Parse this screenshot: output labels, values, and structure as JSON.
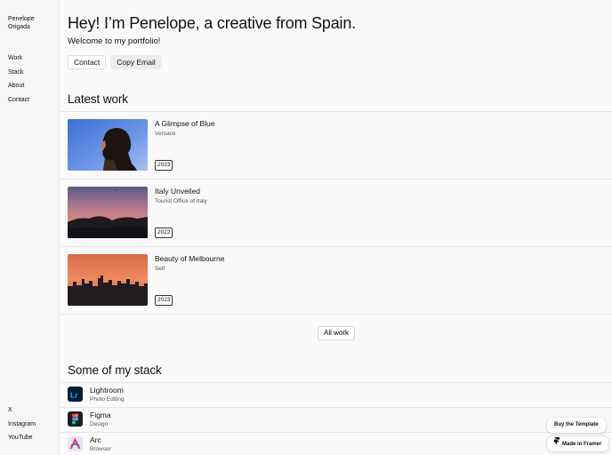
{
  "sidebar": {
    "brand": "Penelope Origada",
    "nav": [
      "Work",
      "Stack",
      "About",
      "Contact"
    ],
    "social": [
      "X",
      "Instagram",
      "YouTube"
    ]
  },
  "hero": {
    "title": "Hey! I’m Penelope, a creative from Spain.",
    "subtitle": "Welcome to my portfolio!",
    "contact_label": "Contact",
    "copy_email_label": "Copy Email"
  },
  "latest": {
    "heading": "Latest work",
    "items": [
      {
        "title": "A Glimpse of Blue",
        "client": "Versace",
        "year": "2023"
      },
      {
        "title": "Italy Unveiled",
        "client": "Tourist Office of Italy",
        "year": "2022"
      },
      {
        "title": "Beauty of Melbourne",
        "client": "Self",
        "year": "2023"
      }
    ],
    "all_work_label": "All work"
  },
  "stack": {
    "heading": "Some of my stack",
    "items": [
      {
        "name": "Lightroom",
        "role": "Photo Editing",
        "icon": "lightroom-icon"
      },
      {
        "name": "Figma",
        "role": "Design",
        "icon": "figma-icon"
      },
      {
        "name": "Arc",
        "role": "Browser",
        "icon": "arc-icon"
      }
    ]
  },
  "floating": {
    "buy_label": "Buy the Template",
    "framer_label": "Made in Framer"
  },
  "colors": {
    "sidebar_bg": "#f6f6f6",
    "page_bg": "#fafafa",
    "text": "#111111",
    "lightroom": "#001e36"
  }
}
